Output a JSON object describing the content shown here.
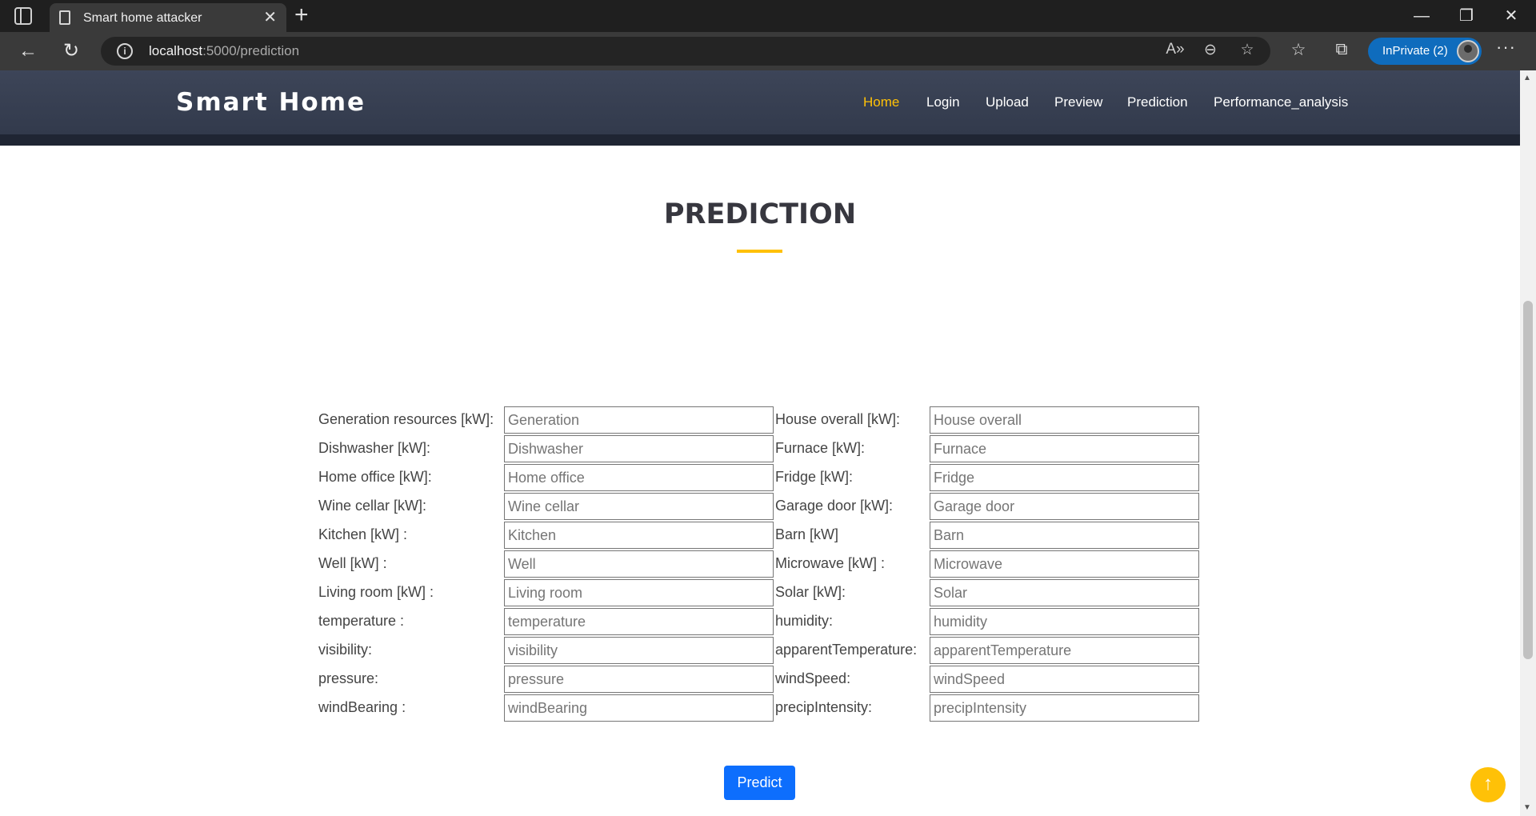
{
  "browser": {
    "tab_title": "Smart home attacker",
    "tab_close": "✕",
    "new_tab": "+",
    "url_host": "localhost",
    "url_path": ":5000/prediction",
    "inprivate_label": "InPrivate (2)",
    "window_minimize": "—",
    "window_restore": "❐",
    "window_close": "✕",
    "more": "···"
  },
  "site": {
    "brand": "Smart Home",
    "nav": [
      {
        "label": "Home",
        "active": true
      },
      {
        "label": "Login",
        "active": false
      },
      {
        "label": "Upload",
        "active": false
      },
      {
        "label": "Preview",
        "active": false
      },
      {
        "label": "Prediction",
        "active": false
      },
      {
        "label": "Performance_analysis",
        "active": false
      }
    ],
    "accent_color": "#ffc107"
  },
  "section": {
    "title": "PREDICTION"
  },
  "form": {
    "rows": [
      {
        "left_label": "Generation resources [kW]:",
        "left_placeholder": "Generation",
        "right_label": "House overall [kW]:",
        "right_placeholder": "House overall"
      },
      {
        "left_label": "Dishwasher [kW]:",
        "left_placeholder": "Dishwasher",
        "right_label": "Furnace [kW]:",
        "right_placeholder": "Furnace"
      },
      {
        "left_label": "Home office [kW]:",
        "left_placeholder": "Home office",
        "right_label": "Fridge [kW]:",
        "right_placeholder": "Fridge"
      },
      {
        "left_label": "Wine cellar [kW]:",
        "left_placeholder": "Wine cellar",
        "right_label": "Garage door [kW]:",
        "right_placeholder": "Garage door"
      },
      {
        "left_label": "Kitchen [kW] :",
        "left_placeholder": "Kitchen",
        "right_label": "Barn [kW]",
        "right_placeholder": "Barn"
      },
      {
        "left_label": "Well [kW] :",
        "left_placeholder": "Well",
        "right_label": "Microwave [kW] :",
        "right_placeholder": "Microwave"
      },
      {
        "left_label": "Living room [kW] :",
        "left_placeholder": "Living room",
        "right_label": "Solar [kW]:",
        "right_placeholder": "Solar"
      },
      {
        "left_label": "temperature :",
        "left_placeholder": "temperature",
        "right_label": "humidity:",
        "right_placeholder": "humidity"
      },
      {
        "left_label": "visibility:",
        "left_placeholder": "visibility",
        "right_label": "apparentTemperature:",
        "right_placeholder": "apparentTemperature"
      },
      {
        "left_label": "pressure:",
        "left_placeholder": "pressure",
        "right_label": "windSpeed:",
        "right_placeholder": "windSpeed"
      },
      {
        "left_label": "windBearing :",
        "left_placeholder": "windBearing",
        "right_label": "precipIntensity:",
        "right_placeholder": "precipIntensity"
      }
    ],
    "submit_label": "Predict"
  },
  "scroll_top_icon": "arrow-up-icon"
}
